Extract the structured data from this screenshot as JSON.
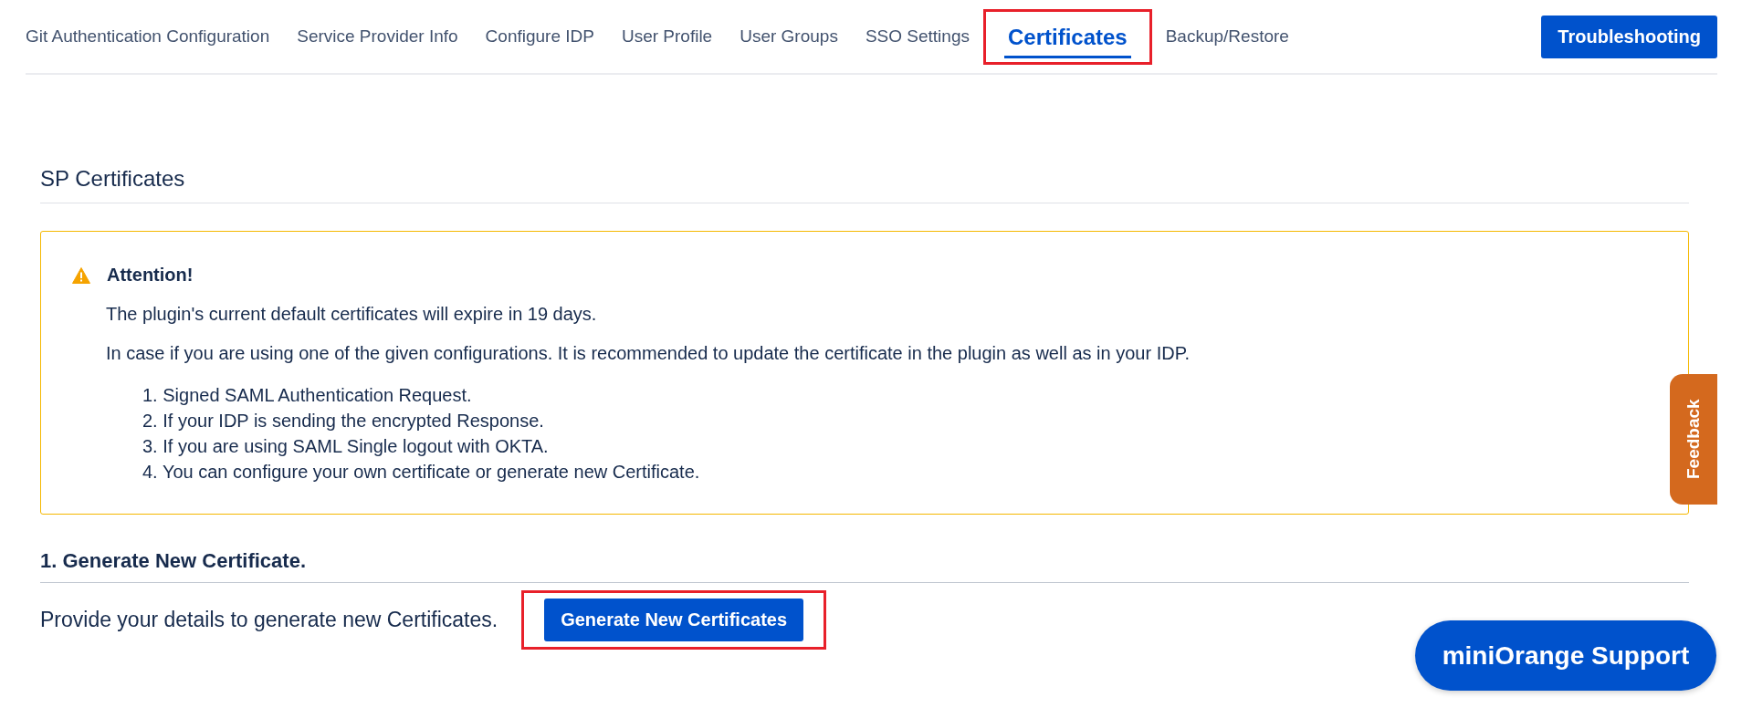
{
  "tabs": [
    {
      "label": "Git Authentication Configuration",
      "selected": false,
      "highlighted": false
    },
    {
      "label": "Service Provider Info",
      "selected": false,
      "highlighted": false
    },
    {
      "label": "Configure IDP",
      "selected": false,
      "highlighted": false
    },
    {
      "label": "User Profile",
      "selected": false,
      "highlighted": false
    },
    {
      "label": "User Groups",
      "selected": false,
      "highlighted": false
    },
    {
      "label": "SSO Settings",
      "selected": false,
      "highlighted": false
    },
    {
      "label": "Certificates",
      "selected": true,
      "highlighted": true
    },
    {
      "label": "Backup/Restore",
      "selected": false,
      "highlighted": false
    }
  ],
  "troubleshooting_button": "Troubleshooting",
  "section_title": "SP Certificates",
  "attention": {
    "title": "Attention!",
    "paragraphs": [
      "The plugin's current default certificates will expire in 19 days.",
      "In case if you are using one of the given configurations. It is recommended to update the certificate in the plugin as well as in your IDP."
    ],
    "items": [
      "1. Signed SAML Authentication Request.",
      "2. If your IDP is sending the encrypted Response.",
      "3. If you are using SAML Single logout with OKTA.",
      "4. You can configure your own certificate or generate new Certificate."
    ]
  },
  "generate": {
    "heading": "1. Generate New Certificate.",
    "text": "Provide your details to generate new Certificates.",
    "button": "Generate New Certificates",
    "highlighted": true
  },
  "feedback_tab": "Feedback",
  "support_button": "miniOrange Support"
}
